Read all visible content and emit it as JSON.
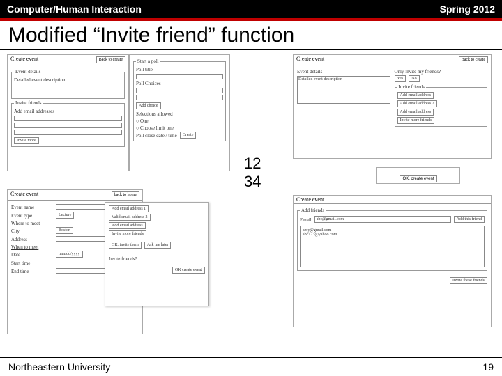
{
  "header": {
    "course": "Computer/Human Interaction",
    "term": "Spring 2012"
  },
  "title": "Modified “Invite friend” function",
  "center": {
    "line1": "12",
    "line2": "34"
  },
  "sketches": {
    "s1": {
      "head_left": "Create event",
      "head_right": "Back to create",
      "sec1_title": "Event details",
      "sec1_text": "Detailed event description",
      "sec2_title": "Invite friends",
      "sec2_sub": "Add email addresses",
      "btn": "Invite more"
    },
    "s2": {
      "sec_title": "Start a poll",
      "l1": "Poll title",
      "l2": "Poll Choices",
      "btn1": "Add choice",
      "l3": "Selections allowed",
      "opt1": "One",
      "opt2": "Choose limit one",
      "l4": "Poll close date / time",
      "btn2": "Create"
    },
    "s3": {
      "head_left": "Create event",
      "head_right": "Back to create",
      "sec_title": "Event details",
      "question": "Only invite my friends?",
      "yes": "Yes",
      "no": "No",
      "text": "Detailed event description",
      "sec2_title": "Invite friends",
      "b1": "Add email address",
      "b2": "Add email address 2",
      "b3": "Add email address",
      "b4": "Invite more friends"
    },
    "s4": {
      "btn": "OK, create event"
    },
    "s5": {
      "head_left": "Create event",
      "head_right": "back to home",
      "l1": "Event name",
      "l2": "Event type",
      "v2": "Lecture",
      "l3": "Where to meet",
      "l4": "City",
      "v4": "Boston",
      "l5": "Address",
      "l6": "When to meet",
      "l7": "Date",
      "v7": "mm/dd/yyyy",
      "l8": "Start time",
      "l9": "End time"
    },
    "s6": {
      "b1": "Add email address 1",
      "b2": "Valid email address 2",
      "b3": "Add email address",
      "b4": "Invite more friends",
      "b5": "OK, invite them",
      "b6": "Ask me later",
      "sec": "Invite friends?",
      "btn": "OK create event"
    },
    "s7": {
      "head_left": "Create event",
      "sec": "Add friends",
      "l1": "Email",
      "v1": "abc@gmail.com",
      "btn1": "Add this friend",
      "e1": "amy@gmail.com",
      "e2": "abc123@yahoo.com",
      "btn2": "Invite these friends"
    }
  },
  "footer": {
    "org": "Northeastern University",
    "page": "19"
  }
}
